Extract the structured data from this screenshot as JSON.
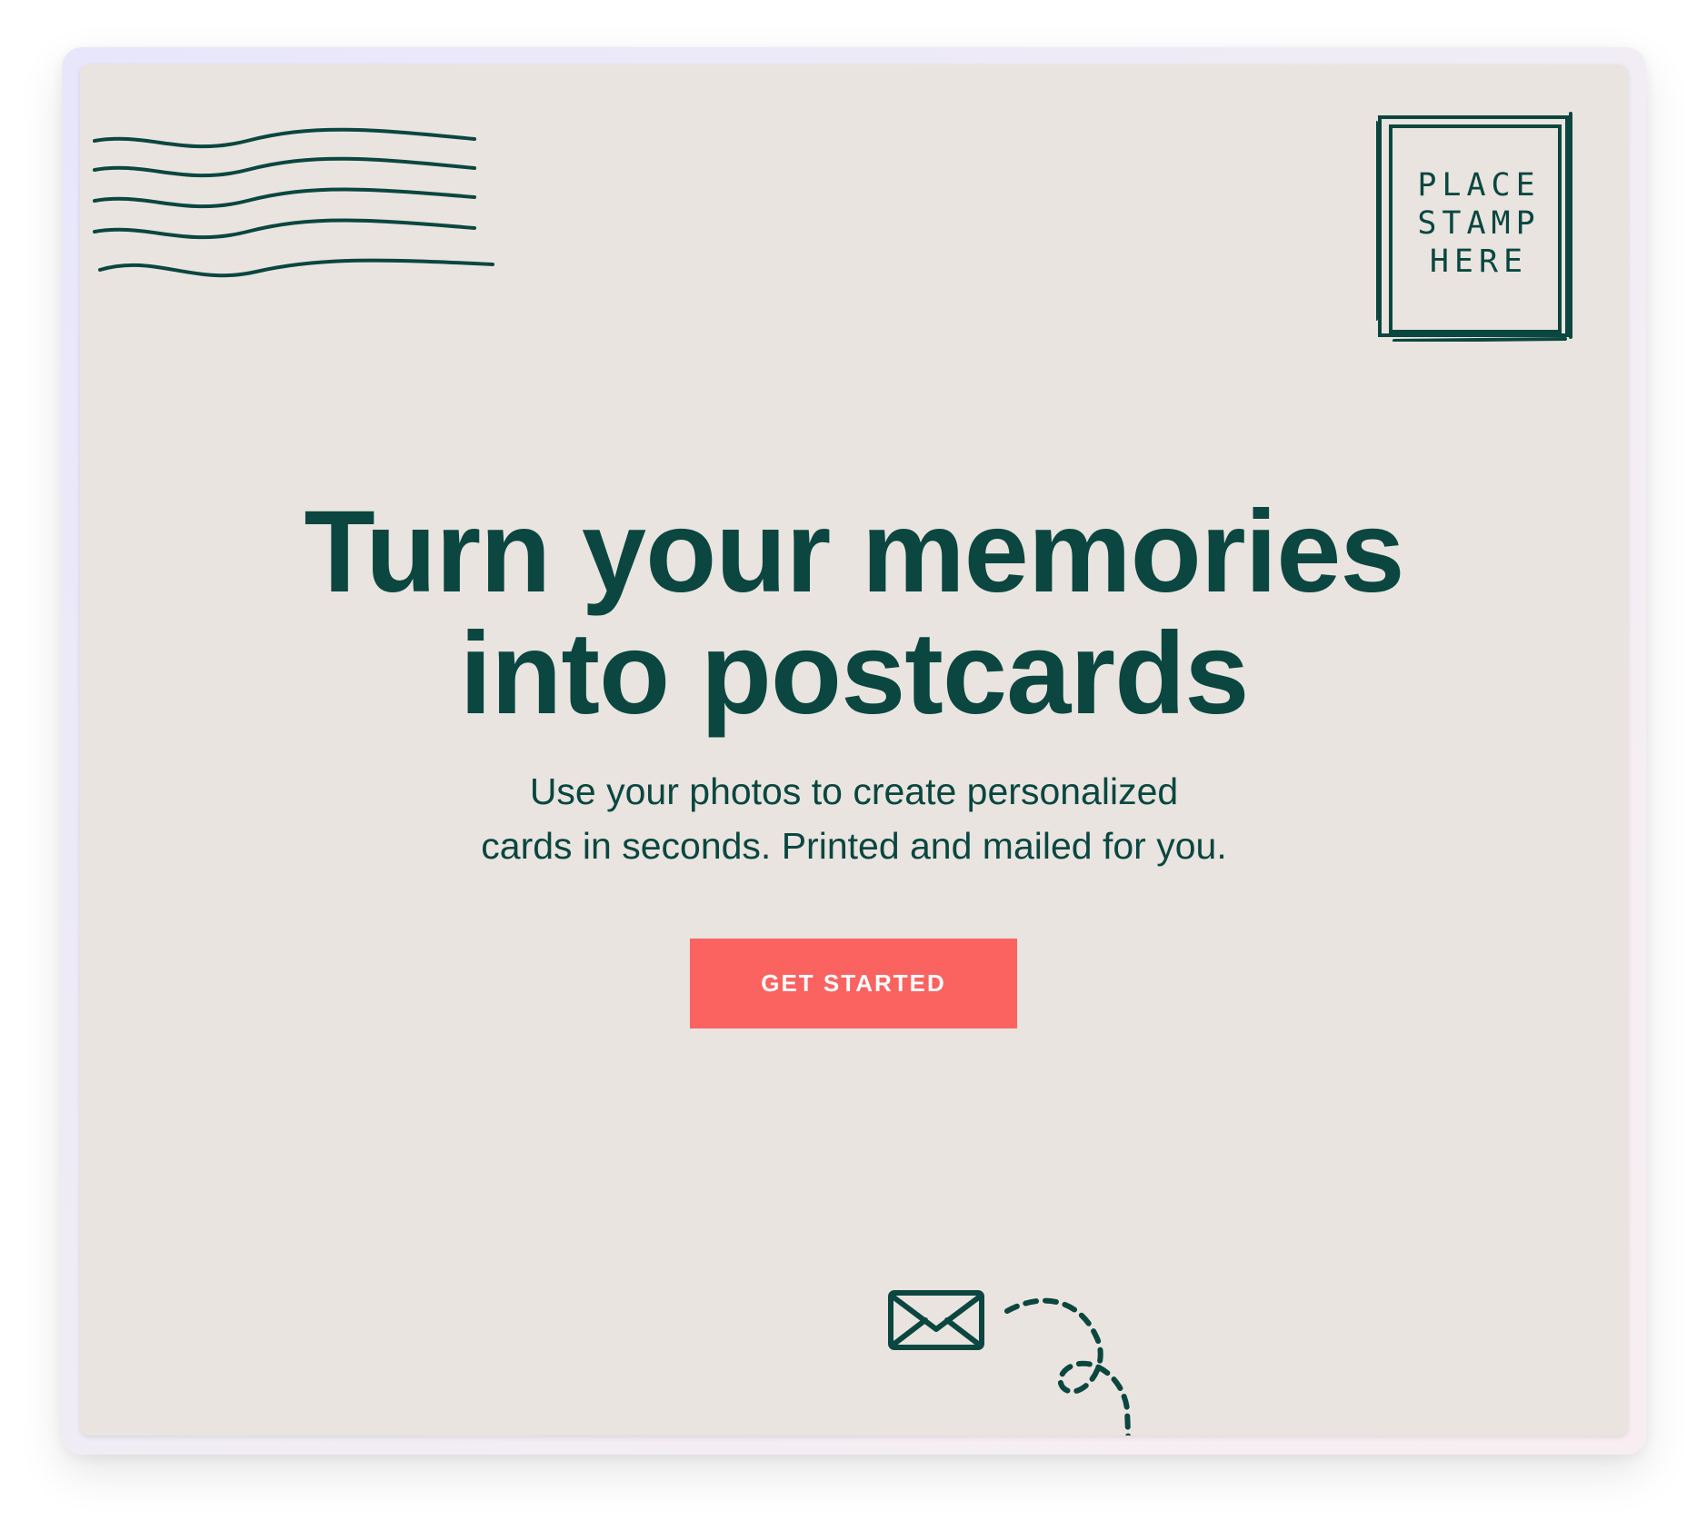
{
  "stamp": {
    "lines": [
      "PLACE",
      "STAMP",
      "HERE"
    ]
  },
  "hero": {
    "title_line1": "Turn your memories",
    "title_line2": "into postcards",
    "subtitle_line1": "Use your photos to create personalized",
    "subtitle_line2": "cards in seconds. Printed and mailed for you."
  },
  "cta": {
    "label": "GET STARTED"
  },
  "icons": {
    "postmark": "postmark-waves-icon",
    "stamp_box": "stamp-placeholder-icon",
    "envelope": "envelope-icon",
    "arrow": "dashed-arrow-icon"
  },
  "colors": {
    "ink": "#0b4640",
    "paper": "#e9e4df",
    "accent": "#fb6360"
  }
}
